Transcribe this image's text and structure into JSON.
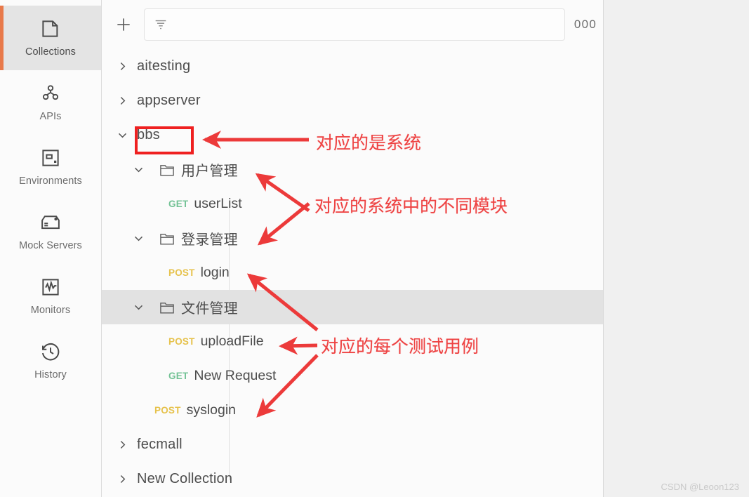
{
  "sidebar": {
    "items": [
      {
        "label": "Collections",
        "icon": "collections-icon",
        "active": true
      },
      {
        "label": "APIs",
        "icon": "apis-icon",
        "active": false
      },
      {
        "label": "Environments",
        "icon": "environments-icon",
        "active": false
      },
      {
        "label": "Mock Servers",
        "icon": "mock-servers-icon",
        "active": false
      },
      {
        "label": "Monitors",
        "icon": "monitors-icon",
        "active": false
      },
      {
        "label": "History",
        "icon": "history-icon",
        "active": false
      }
    ]
  },
  "toolbar": {
    "add_label": "+",
    "add_icon": "plus-icon",
    "filter_icon": "filter-icon",
    "search_value": "",
    "search_placeholder": "",
    "more_label": "000",
    "more_icon": "more-horizontal-icon"
  },
  "tree": {
    "rows": [
      {
        "id": "aitesting",
        "label": "aitesting",
        "kind": "collection",
        "expanded": false,
        "indent": "root",
        "selected": false
      },
      {
        "id": "appserver",
        "label": "appserver",
        "kind": "collection",
        "expanded": false,
        "indent": "root",
        "selected": false
      },
      {
        "id": "bbs",
        "label": "bbs",
        "kind": "collection",
        "expanded": true,
        "indent": "root",
        "selected": false,
        "highlight_box": true
      },
      {
        "id": "user-mgmt",
        "label": "用户管理",
        "kind": "folder",
        "expanded": true,
        "indent": "fold",
        "selected": false
      },
      {
        "id": "userlist",
        "label": "userList",
        "kind": "request",
        "method": "GET",
        "indent": "req",
        "selected": false
      },
      {
        "id": "login-mgmt",
        "label": "登录管理",
        "kind": "folder",
        "expanded": true,
        "indent": "fold",
        "selected": false
      },
      {
        "id": "login",
        "label": "login",
        "kind": "request",
        "method": "POST",
        "indent": "req",
        "selected": false
      },
      {
        "id": "file-mgmt",
        "label": "文件管理",
        "kind": "folder",
        "expanded": true,
        "indent": "fold",
        "selected": true
      },
      {
        "id": "uploadfile",
        "label": "uploadFile",
        "kind": "request",
        "method": "POST",
        "indent": "req",
        "selected": false
      },
      {
        "id": "new-request",
        "label": "New Request",
        "kind": "request",
        "method": "GET",
        "indent": "req",
        "selected": false
      },
      {
        "id": "syslogin",
        "label": "syslogin",
        "kind": "request",
        "method": "POST",
        "indent": "req2",
        "selected": false
      },
      {
        "id": "fecmall",
        "label": "fecmall",
        "kind": "collection",
        "expanded": false,
        "indent": "root",
        "selected": false
      },
      {
        "id": "new-collection",
        "label": "New Collection",
        "kind": "collection",
        "expanded": false,
        "indent": "root",
        "selected": false
      }
    ]
  },
  "annotations": {
    "color": "#ee4242",
    "items": [
      {
        "id": "anno-system",
        "text": "对应的是系统"
      },
      {
        "id": "anno-modules",
        "text": "对应的系统中的不同模块"
      },
      {
        "id": "anno-cases",
        "text": "对应的每个测试用例"
      }
    ]
  },
  "watermark": {
    "text": "CSDN @Leoon123"
  }
}
